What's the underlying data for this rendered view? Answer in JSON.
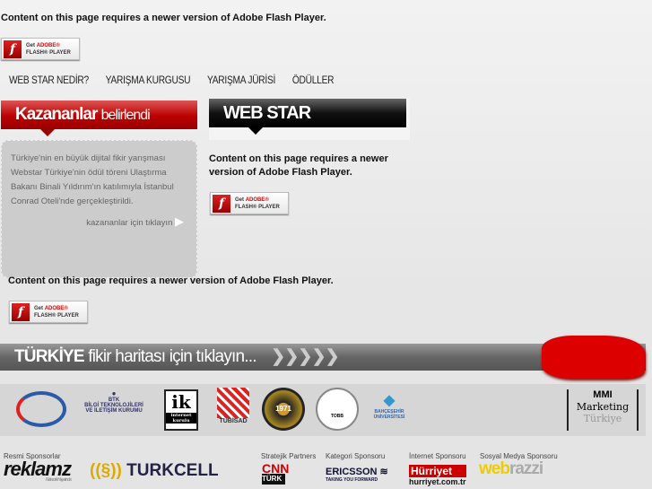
{
  "flash": {
    "message": "Content on this page requires a newer version of Adobe Flash Player.",
    "message_wrapped_1": "Content on this page requires a newer",
    "message_wrapped_2": "version of Adobe Flash Player.",
    "button_get": "Get",
    "button_adobe": "ADOBE®",
    "button_player": "FLASH® PLAYER"
  },
  "nav": [
    "WEB STAR NEDİR?",
    "YARIŞMA KURGUSU",
    "YARIŞMA JÜRİSİ",
    "ÖDÜLLER"
  ],
  "winners": {
    "title_bold": "Kazananlar",
    "title_light": "belirlendi",
    "text": "Türkiye'nin en büyük dijital fikir yarışması Webstar Türkiye'nin ödül töreni Ulaştırma Bakanı Binali Yıldırım'ın katılımıyla İstanbul Conrad Oteli'nde gerçekleştirildi.",
    "link": "kazananlar için tıklayın"
  },
  "webstar": {
    "title": "WEB STAR"
  },
  "map_banner": {
    "bold": "TÜRKİYE",
    "text": "fikir haritası için tıklayın..."
  },
  "partners": [
    "BTK",
    "BİLGİ TEKNOLOJİLERİ VE İLETİŞİM KURUMU",
    "ik",
    "internet kurulu",
    "TÜBİSAD",
    "1971",
    "TOBB",
    "BAHÇEŞEHİR ÜNİVERSİTESİ",
    "MMI",
    "Marketing",
    "Türkiye"
  ],
  "sponsors": {
    "official_label": "Resmi Sponsorlar",
    "reklamz": "reklamz",
    "reklamz_tag": "Network Hayatında",
    "turkcell": "TURKCELL",
    "strategic_label": "Stratejik Partners",
    "cnn": "CNN",
    "cnn_turk": "TÜRK",
    "category_label": "Kategori Sponsoru",
    "ericsson": "ERICSSON",
    "ericsson_tag": "TAKING YOU FORWARD",
    "internet_label": "İnternet Sponsoru",
    "hurriyet": "Hürriyet",
    "hurriyet_url": "hurriyet.com.tr",
    "social_label": "Sosyal Medya Sponsoru",
    "webrazzi_a": "web",
    "webrazzi_b": "razzi"
  }
}
